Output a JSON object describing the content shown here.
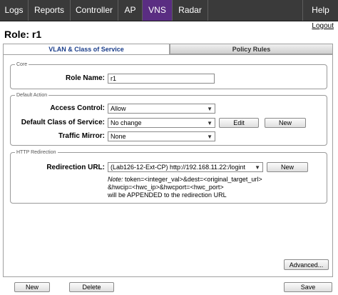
{
  "nav": {
    "items": [
      {
        "label": "Logs"
      },
      {
        "label": "Reports"
      },
      {
        "label": "Controller"
      },
      {
        "label": "AP"
      },
      {
        "label": "VNS"
      },
      {
        "label": "Radar"
      }
    ],
    "help": "Help",
    "logout": "Logout",
    "active": "VNS",
    "active_color": "#5a2d82"
  },
  "page": {
    "title": "Role: r1"
  },
  "tabs": [
    {
      "label": "VLAN & Class of Service",
      "active": true
    },
    {
      "label": "Policy Rules",
      "active": false
    }
  ],
  "core": {
    "legend": "Core",
    "role_name_label": "Role Name:",
    "role_name_value": "r1"
  },
  "default_action": {
    "legend": "Default Action",
    "access_control_label": "Access Control:",
    "access_control_value": "Allow",
    "cos_label": "Default Class of Service:",
    "cos_value": "No change",
    "edit_label": "Edit",
    "new_label": "New",
    "traffic_mirror_label": "Traffic Mirror:",
    "traffic_mirror_value": "None"
  },
  "http_redirection": {
    "legend": "HTTP Redirection",
    "url_label": "Redirection URL:",
    "url_value": "(Lab126-12-Ext-CP) http://192.168.11.22:/logint",
    "new_label": "New",
    "note_prefix": "Note:",
    "note_line1": " token=<integer_val>&dest=<original_target_url>",
    "note_line2": "&hwcip=<hwc_ip>&hwcport=<hwc_port>",
    "note_line3": "will be APPENDED to the redirection URL"
  },
  "footer": {
    "advanced_label": "Advanced...",
    "new_label": "New",
    "delete_label": "Delete",
    "save_label": "Save"
  }
}
